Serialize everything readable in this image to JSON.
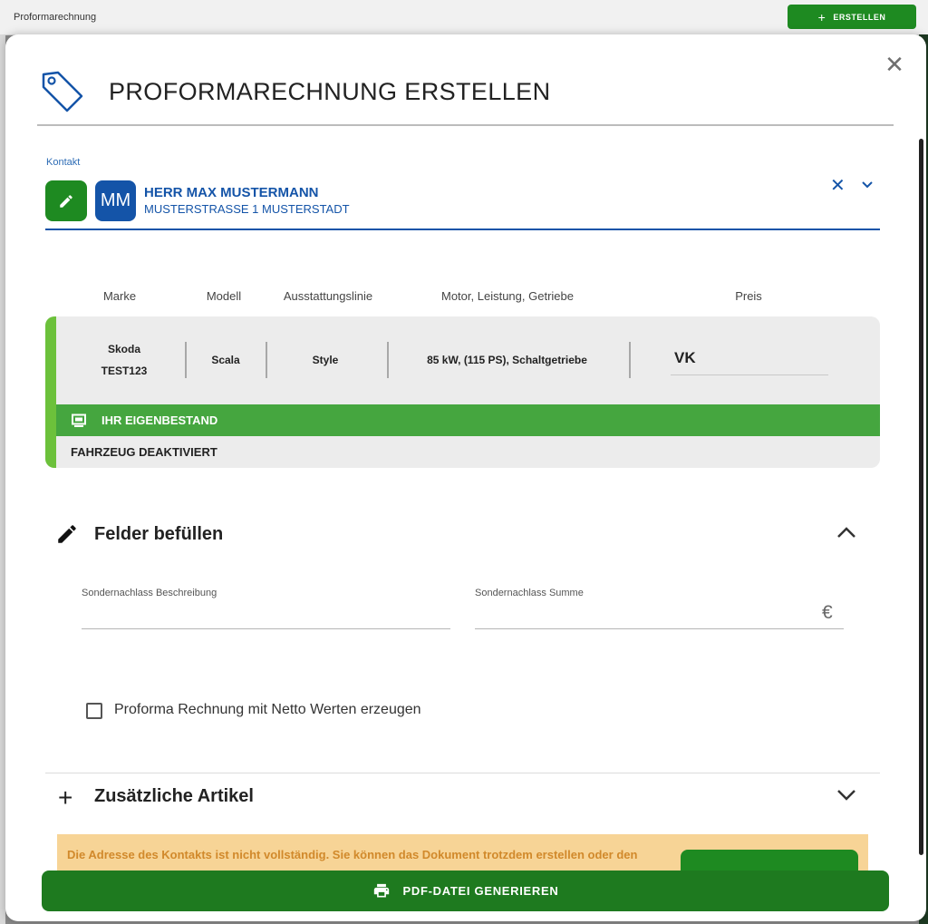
{
  "background": {
    "title": "Proformarechnung",
    "create_label": "ERSTELLEN"
  },
  "modal": {
    "title": "PROFORMARECHNUNG ERSTELLEN",
    "icon": "price-tag-icon"
  },
  "contact": {
    "label": "Kontakt",
    "initials": "MM",
    "name": "HERR MAX MUSTERMANN",
    "address": "MUSTERSTRASSE 1 MUSTERSTADT"
  },
  "vehicle": {
    "headers": {
      "brand": "Marke",
      "model": "Modell",
      "trim": "Ausstattungslinie",
      "engine": "Motor, Leistung, Getriebe",
      "price": "Preis"
    },
    "brand": "Skoda",
    "id": "TEST123",
    "model": "Scala",
    "trim": "Style",
    "engine": "85 kW, (115 PS), Schaltgetriebe",
    "price_label": "VK",
    "stock_label": "IHR EIGENBESTAND",
    "status": "FAHRZEUG DEAKTIVIERT",
    "accent_color": "#6cc13b",
    "stock_color": "#45a63f"
  },
  "fill_section": {
    "title": "Felder befüllen",
    "discount_desc_label": "Sondernachlass Beschreibung",
    "discount_desc_value": "",
    "discount_sum_label": "Sondernachlass Summe",
    "discount_sum_value": "",
    "currency": "€",
    "netto_checkbox_label": "Proforma Rechnung mit Netto Werten erzeugen",
    "netto_checked": false
  },
  "extra_section": {
    "title": "Zusätzliche Artikel"
  },
  "warning": {
    "text": "Die Adresse des Kontakts ist nicht vollständig. Sie können das Dokument trotzdem erstellen oder den"
  },
  "actions": {
    "generate_pdf": "PDF-DATEI GENERIEREN"
  },
  "colors": {
    "primary_green": "#1e8a21",
    "primary_blue": "#1454a8",
    "warning_bg": "#f7d496"
  }
}
